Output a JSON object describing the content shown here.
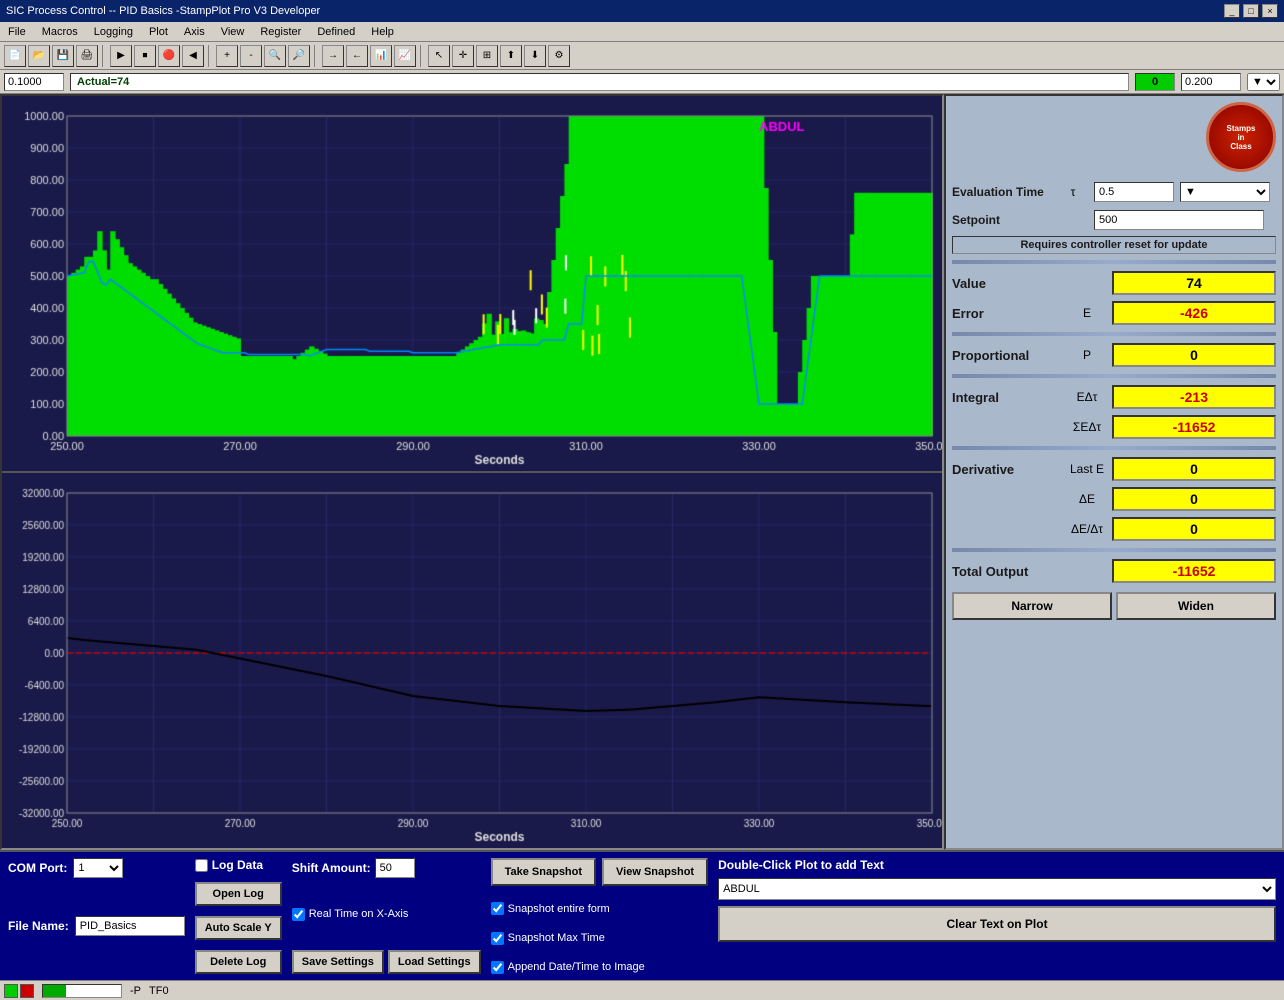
{
  "titleBar": {
    "title": "SIC Process Control -- PID Basics -StampPlot Pro V3 Developer",
    "controls": [
      "_",
      "□",
      "×"
    ]
  },
  "menuBar": {
    "items": [
      "File",
      "Macros",
      "Logging",
      "Plot",
      "Axis",
      "View",
      "Register",
      "Defined",
      "Help"
    ]
  },
  "axisBar": {
    "leftValue": "0.1000",
    "middleLabel": "Actual=74",
    "greenValue": "0",
    "rightValue": "0.200"
  },
  "rightPanel": {
    "logo": {
      "line1": "Stamps",
      "line2": "in",
      "line3": "Class"
    },
    "evaluationTime": {
      "label": "Evaluation Time",
      "symbol": "τ",
      "value": "0.5"
    },
    "setpoint": {
      "label": "Setpoint",
      "value": "500"
    },
    "resetNotice": "Requires controller reset for update",
    "value": {
      "label": "Value",
      "display": "74"
    },
    "error": {
      "label": "Error",
      "symbol": "E",
      "display": "-426"
    },
    "proportional": {
      "label": "Proportional",
      "symbol": "P",
      "display": "0"
    },
    "integral": {
      "label": "Integral",
      "symbol": "EΔτ",
      "display": "-213",
      "sumSymbol": "ΣEΔτ",
      "sumDisplay": "-11652"
    },
    "derivative": {
      "label": "Derivative",
      "symbol": "Last E",
      "display": "0",
      "deltaE": "ΔE",
      "deltaEDisplay": "0",
      "deltaEOverDeltaTau": "ΔE/Δτ",
      "deltaEOverDeltaTauDisplay": "0"
    },
    "totalOutput": {
      "label": "Total Output",
      "display": "-11652"
    },
    "narrowBtn": "Narrow",
    "widenBtn": "Widen"
  },
  "bottomPanel": {
    "comPort": {
      "label": "COM Port:",
      "value": "1"
    },
    "fileName": {
      "label": "File Name:",
      "value": "PID_Basics"
    },
    "logData": "Log Data",
    "shiftAmount": {
      "label": "Shift Amount:",
      "value": "50"
    },
    "openLog": "Open Log",
    "autoScaleY": "Auto Scale Y",
    "deleteLog": "Delete Log",
    "realTimeXAxis": "Real Time on X-Axis",
    "saveSettings": "Save Settings",
    "loadSettings": "Load Settings",
    "snapshot": {
      "takeBtn": "Take Snapshot",
      "viewBtn": "View Snapshot",
      "entireForm": "Snapshot entire form",
      "maxTime": "Snapshot Max Time",
      "appendDateTime": "Append Date/Time to Image"
    },
    "doubleClickLabel": "Double-Click Plot to add Text",
    "nameValue": "ABDUL",
    "clearTextBtn": "Clear Text on Plot"
  },
  "statusBar": {
    "text1": "-P",
    "text2": "TF0"
  },
  "chart1": {
    "title": "ABDUL",
    "xLabel": "Seconds",
    "xMin": 250,
    "xMax": 350,
    "yMin": 0,
    "yMax": 1000,
    "xTicks": [
      250,
      270,
      290,
      310,
      330,
      350
    ],
    "yTicks": [
      0,
      100,
      200,
      300,
      400,
      500,
      600,
      700,
      800,
      900,
      1000
    ]
  },
  "chart2": {
    "xLabel": "Seconds",
    "xMin": 250,
    "xMax": 350,
    "yMin": -32000,
    "yMax": 32000,
    "xTicks": [
      250,
      270,
      290,
      310,
      330,
      350
    ],
    "yTicks": [
      -32000,
      -25600,
      -19200,
      -12800,
      -6400,
      0,
      6400,
      12800,
      19200,
      25600,
      32000
    ]
  }
}
